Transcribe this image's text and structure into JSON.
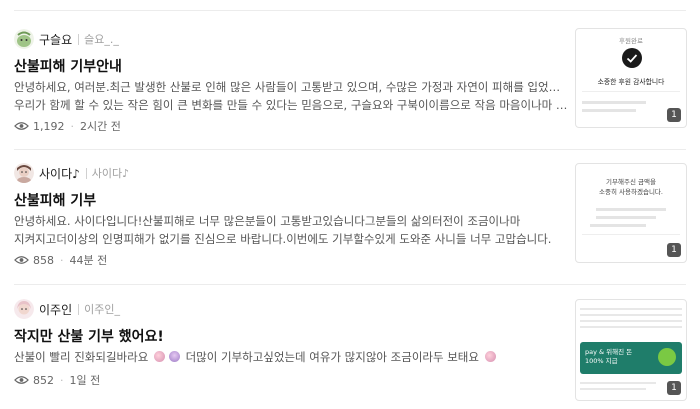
{
  "posts": [
    {
      "author_name": "구슬요",
      "author_id": "슬요_._",
      "title": "산불피해 기부안내",
      "snippet_lines": [
        "안녕하세요, 여러분.최근 발생한 산불로 인해 많은 사람들이 고통받고 있으며, 수많은 가정과 자연이 피해를 입었습니다.",
        "우리가 함께 할 수 있는 작은 힘이 큰 변화를 만들 수 있다는 믿음으로, 구슬요와 구북이이름으로 작음 마음이나마 기부로..."
      ],
      "views": "1,192",
      "time": "2시간 전",
      "thumb_count": "1",
      "thumb_texts": [
        "후원완료",
        "소중한 후원 감사합니다"
      ],
      "avatar_color": "#9fc487",
      "eye_icon": "eye-icon"
    },
    {
      "author_name": "사이다♪",
      "author_id": "사이다♪",
      "title": "산불피해 기부",
      "snippet_lines": [
        "안녕하세요. 사이다입니다!산불피해로 너무 많은분들이 고통받고있습니다그분들의 삶의터전이 조금이나마",
        "지켜지고더이상의 인명피해가 없기를 진심으로 바랍니다.이번에도 기부할수있게 도와준 사니들 너무 고맙습니다."
      ],
      "views": "858",
      "time": "44분 전",
      "thumb_count": "1",
      "thumb_texts": [
        "기부해주신 금액을",
        "소중히 사용하겠습니다."
      ],
      "avatar_color": "#c9a9a0",
      "eye_icon": "eye-icon"
    },
    {
      "author_name": "이주인",
      "author_id": "이주인_",
      "title_prefix": "작지만 ",
      "title_bold": "산불 기부",
      "title_suffix": " 했어요!",
      "snippet_part1": "산불이 빨리 진화되길바라요 ",
      "snippet_part2": " 더많이 기부하고싶었는데 여유가 많지않아 조금이라두 보태요 ",
      "views": "852",
      "time": "1일 전",
      "thumb_count": "1",
      "thumb_texts": [
        "pay & 위해진 돈",
        "100% 지급"
      ],
      "avatar_color": "#e8c2c8",
      "eye_icon": "eye-icon"
    }
  ],
  "colors": {
    "text_primary": "#111111",
    "text_secondary": "#555555",
    "muted": "#a0a0a0",
    "divider": "#ececec",
    "badge_bg": "#555555"
  }
}
